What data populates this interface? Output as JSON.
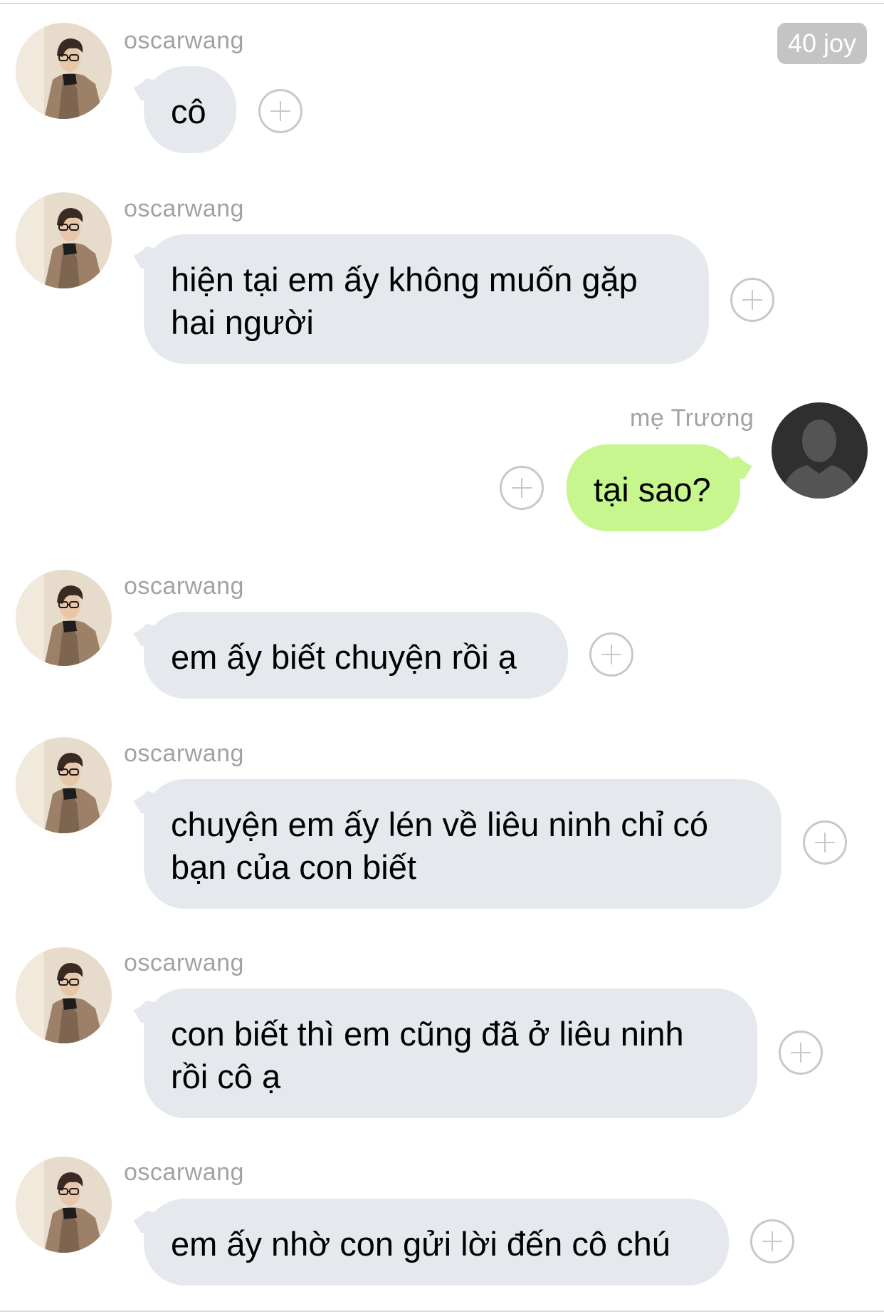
{
  "badge": {
    "label": "40 joy"
  },
  "colors": {
    "incoming_bubble": "#e5e8ed",
    "outgoing_bubble": "#c7f68e",
    "sender_text": "#a2a2a2",
    "badge_bg": "#c4c4c4"
  },
  "messages": [
    {
      "sender": "oscarwang",
      "direction": "incoming",
      "text": "cô",
      "avatar": "profile-photo-man-glasses"
    },
    {
      "sender": "oscarwang",
      "direction": "incoming",
      "text": "hiện tại em ấy không muốn gặp\nhai người",
      "avatar": "profile-photo-man-glasses"
    },
    {
      "sender": "mẹ Trương",
      "direction": "outgoing",
      "text": "tại sao?",
      "avatar": "default-person-silhouette"
    },
    {
      "sender": "oscarwang",
      "direction": "incoming",
      "text": "em ấy biết chuyện rồi ạ",
      "avatar": "profile-photo-man-glasses"
    },
    {
      "sender": "oscarwang",
      "direction": "incoming",
      "text": "chuyện em ấy lén về liêu ninh chỉ có\nbạn của con biết",
      "avatar": "profile-photo-man-glasses"
    },
    {
      "sender": "oscarwang",
      "direction": "incoming",
      "text": "con biết thì em cũng đã ở liêu ninh\nrồi cô ạ",
      "avatar": "profile-photo-man-glasses"
    },
    {
      "sender": "oscarwang",
      "direction": "incoming",
      "text": "em ấy nhờ con gửi lời đến cô chú",
      "avatar": "profile-photo-man-glasses"
    }
  ]
}
